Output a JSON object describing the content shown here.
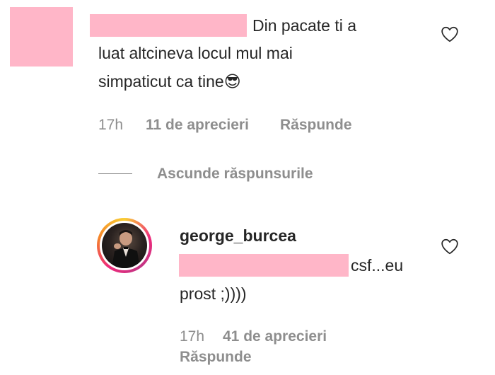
{
  "comment1": {
    "text_line1": "Din pacate ti a",
    "text_line2": "luat altcineva locul mul mai",
    "text_line3": "simpaticut ca tine",
    "emoji": "😎",
    "time": "17h",
    "likes": "11 de aprecieri",
    "reply_label": "Răspunde"
  },
  "replies_toggle": {
    "label": "Ascunde răspunsurile"
  },
  "reply1": {
    "username": "george_burcea",
    "text_after_redaction": "csf...eu",
    "text_line2": "prost ;))))",
    "time": "17h",
    "likes": "41 de aprecieri",
    "reply_label": "Răspunde"
  },
  "colors": {
    "redaction": "#ffb6c8",
    "secondary_text": "#8e8e8e",
    "primary_text": "#262626"
  }
}
